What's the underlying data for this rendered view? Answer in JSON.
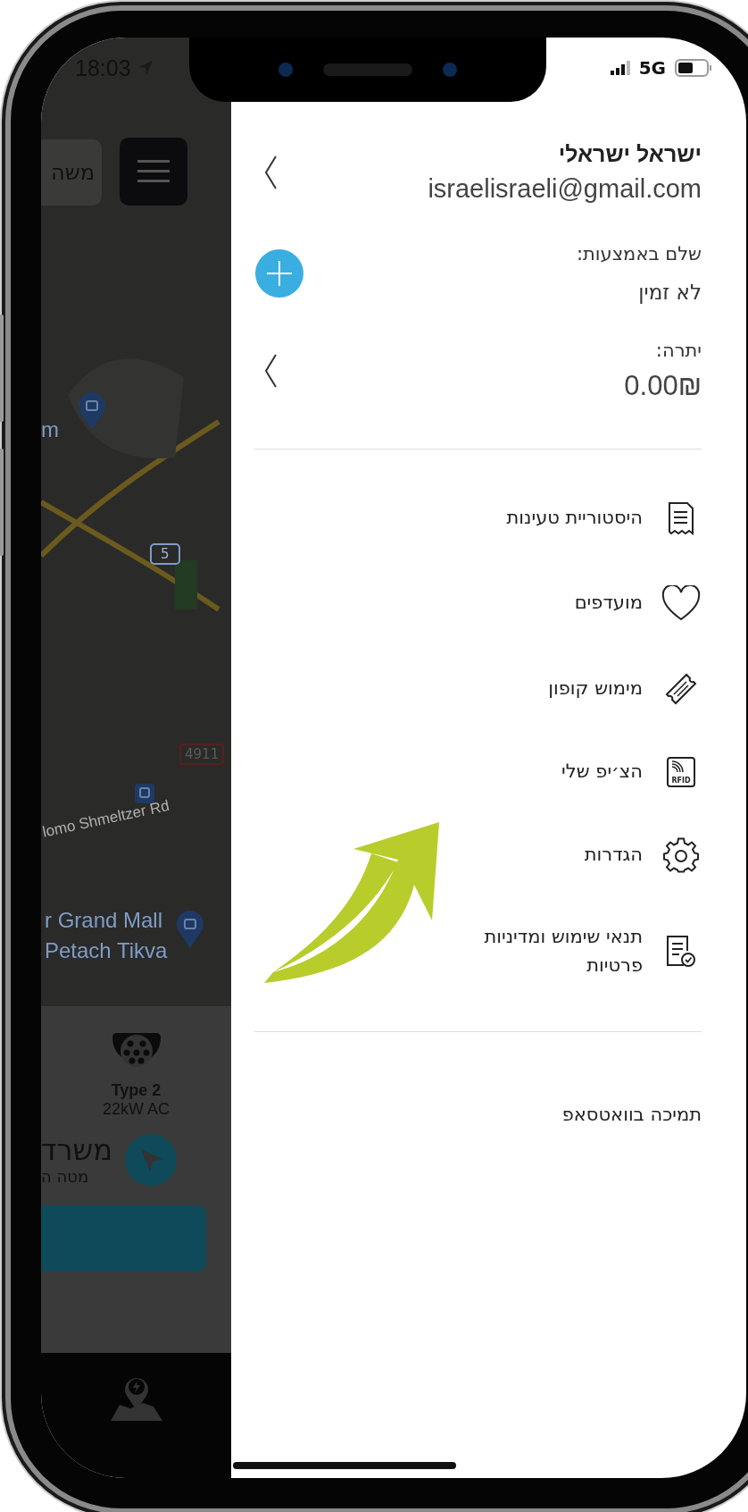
{
  "status_bar": {
    "time": "18:03",
    "network": "5G"
  },
  "map": {
    "search_button": "משה",
    "labels": [
      {
        "kind": "text",
        "text": "m"
      },
      {
        "kind": "pin"
      },
      {
        "kind": "shield",
        "text": "5"
      },
      {
        "kind": "route",
        "text": "4911"
      },
      {
        "kind": "transit"
      },
      {
        "kind": "street",
        "text": "lomo Shmeltzer Rd"
      },
      {
        "kind": "text",
        "text": "r Grand Mall"
      },
      {
        "kind": "text",
        "text": "Petach Tikva"
      },
      {
        "kind": "pin"
      }
    ]
  },
  "station_card": {
    "connector": "Type 2",
    "power": "22kW AC",
    "title": "משרד",
    "subtitle": "מטה ה"
  },
  "drawer": {
    "user": {
      "name": "ישראל ישראלי",
      "email": "israelisraeli@gmail.com"
    },
    "payment": {
      "label": "שלם באמצעות:",
      "value": "לא זמין"
    },
    "balance": {
      "label": "יתרה:",
      "amount": "0.00₪"
    },
    "menu": [
      {
        "label": "היסטוריית טעינות",
        "kind": "receipt"
      },
      {
        "label": "מועדפים",
        "kind": "heart"
      },
      {
        "label": "מימוש קופון",
        "kind": "ticket"
      },
      {
        "label": "הצ׳יפ שלי",
        "kind": "rfid",
        "icon_text": "RFID"
      },
      {
        "label": "הגדרות",
        "kind": "gear"
      },
      {
        "label": "תנאי שימוש ומדיניות פרטיות",
        "kind": "document"
      }
    ],
    "support": "תמיכה בוואטסאפ"
  }
}
